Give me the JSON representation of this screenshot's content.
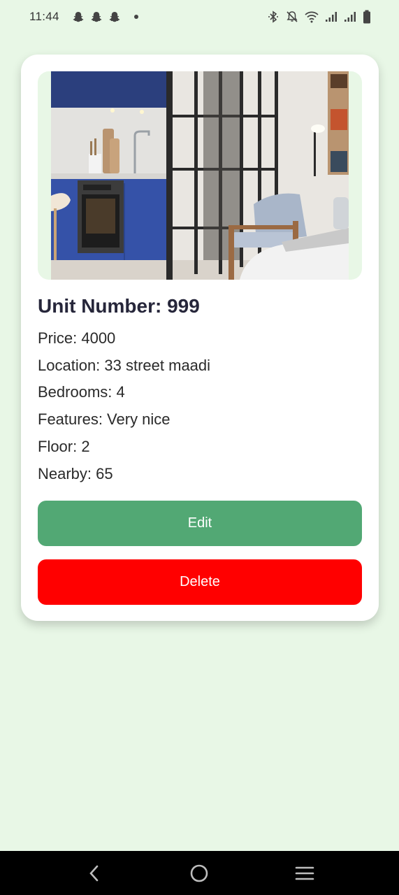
{
  "status_bar": {
    "time": "11:44",
    "notification_icons": [
      "snapchat-icon",
      "snapchat-icon",
      "snapchat-icon",
      "dot-icon"
    ],
    "system_icons": [
      "bluetooth-icon",
      "mute-icon",
      "wifi-icon",
      "signal-icon",
      "signal-icon",
      "battery-icon"
    ]
  },
  "unit": {
    "title": "Unit Number: 999",
    "price": "Price: 4000",
    "location": "Location: 33 street maadi",
    "bedrooms": "Bedrooms: 4",
    "features": "Features: Very nice",
    "floor": "Floor: 2",
    "nearby": "Nearby: 65"
  },
  "actions": {
    "edit_label": "Edit",
    "delete_label": "Delete"
  },
  "colors": {
    "background": "#e8f7e6",
    "edit": "#52a874",
    "delete": "#ff0000"
  },
  "nav_bar": {
    "buttons": [
      "back-icon",
      "home-icon",
      "recents-icon"
    ]
  }
}
